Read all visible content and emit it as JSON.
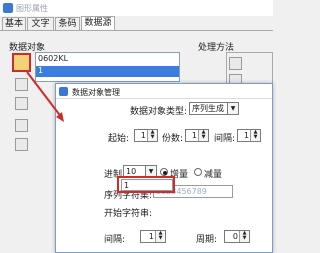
{
  "window": {
    "title": "图形属性"
  },
  "tabs": [
    {
      "label": "基本"
    },
    {
      "label": "文字"
    },
    {
      "label": "条码"
    },
    {
      "label": "数据源"
    }
  ],
  "left": {
    "section_label": "数据对象",
    "items": [
      {
        "label": "0602KL"
      },
      {
        "label": "1"
      }
    ]
  },
  "right": {
    "section_label": "处理方法"
  },
  "dialog": {
    "title": "数据对象管理",
    "type_label": "数据对象类型:",
    "type_value": "序列生成",
    "start_label": "起始:",
    "start_value": "1",
    "copies_label": "份数:",
    "copies_value": "1",
    "interval_label": "间隔:",
    "interval_value": "1",
    "base_label": "进制",
    "base_value": "10",
    "increase_label": "增量",
    "decrease_label": "减量",
    "charset_label": "序列字符集:",
    "charset_value": "0123456789",
    "start_char_label": "开始字符串:",
    "start_char_value": "1",
    "bottom_interval_label": "间隔:",
    "bottom_interval_value": "1",
    "period_label": "周期:",
    "period_value": "0"
  },
  "colors": {
    "highlight": "#d12a2a",
    "accent": "#3b7de0"
  }
}
